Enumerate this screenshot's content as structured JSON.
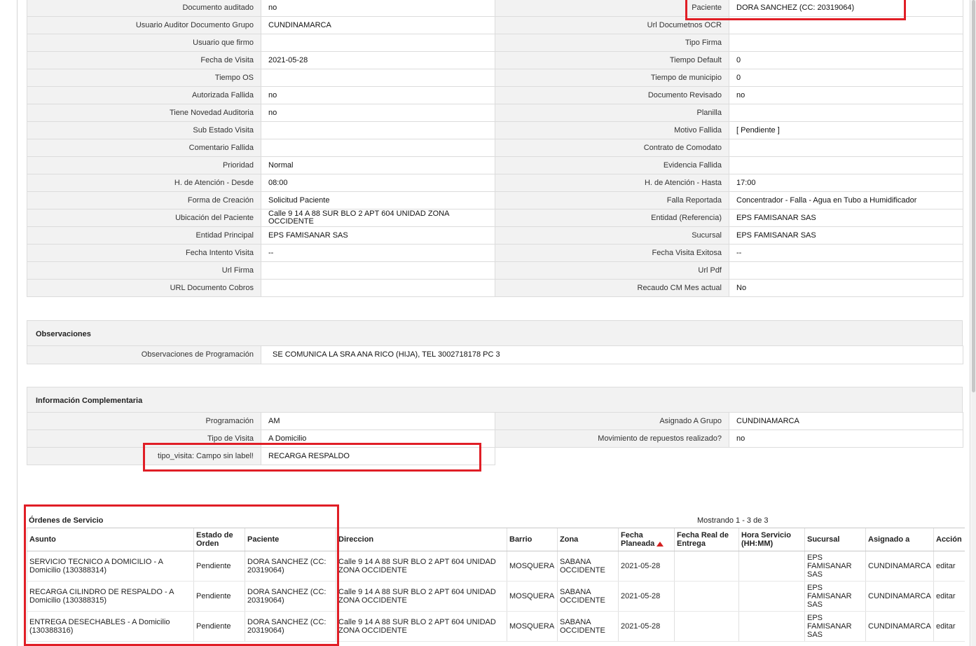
{
  "details": {
    "rows": [
      {
        "l1": "Documento auditado",
        "v1": "no",
        "l2": "Paciente",
        "v2": "DORA SANCHEZ (CC: 20319064)"
      },
      {
        "l1": "Usuario Auditor Documento Grupo",
        "v1": "CUNDINAMARCA",
        "l2": "Url Documetnos OCR",
        "v2": ""
      },
      {
        "l1": "Usuario que firmo",
        "v1": "",
        "l2": "Tipo Firma",
        "v2": ""
      },
      {
        "l1": "Fecha de Visita",
        "v1": "2021-05-28",
        "l2": "Tiempo Default",
        "v2": "0"
      },
      {
        "l1": "Tiempo OS",
        "v1": "",
        "l2": "Tiempo de municipio",
        "v2": "0"
      },
      {
        "l1": "Autorizada Fallida",
        "v1": "no",
        "l2": "Documento Revisado",
        "v2": "no"
      },
      {
        "l1": "Tiene Novedad Auditoria",
        "v1": "no",
        "l2": "Planilla",
        "v2": ""
      },
      {
        "l1": "Sub Estado Visita",
        "v1": "",
        "l2": "Motivo Fallida",
        "v2": "[ Pendiente ]"
      },
      {
        "l1": "Comentario Fallida",
        "v1": "",
        "l2": "Contrato de Comodato",
        "v2": ""
      },
      {
        "l1": "Prioridad",
        "v1": "Normal",
        "l2": "Evidencia Fallida",
        "v2": ""
      },
      {
        "l1": "H. de Atención - Desde",
        "v1": "08:00",
        "l2": "H. de Atención - Hasta",
        "v2": "17:00"
      },
      {
        "l1": "Forma de Creación",
        "v1": "Solicitud Paciente",
        "l2": "Falla Reportada",
        "v2": "Concentrador - Falla - Agua en Tubo a Humidificador"
      },
      {
        "l1": "Ubicación del Paciente",
        "v1": "Calle 9 14 A 88 SUR BLO 2 APT 604 UNIDAD ZONA OCCIDENTE",
        "l2": "Entidad (Referencia)",
        "v2": "EPS FAMISANAR SAS"
      },
      {
        "l1": "Entidad Principal",
        "v1": "EPS FAMISANAR SAS",
        "l2": "Sucursal",
        "v2": "EPS FAMISANAR SAS"
      },
      {
        "l1": "Fecha Intento Visita",
        "v1": "--",
        "l2": "Fecha Visita Exitosa",
        "v2": "--"
      },
      {
        "l1": "Url Firma",
        "v1": "",
        "l2": "Url Pdf",
        "v2": ""
      },
      {
        "l1": "URL Documento Cobros",
        "v1": "",
        "l2": "Recaudo CM Mes actual",
        "v2": "No"
      }
    ]
  },
  "observaciones": {
    "title": "Observaciones",
    "label": "Observaciones de Programación",
    "value": "SE COMUNICA LA SRA ANA RICO (HIJA), TEL 3002718178 PC 3"
  },
  "complementaria": {
    "title": "Información Complementaria",
    "rows": [
      {
        "l1": "Programación",
        "v1": "AM",
        "l2": "Asignado A Grupo",
        "v2": "CUNDINAMARCA"
      },
      {
        "l1": "Tipo de Visita",
        "v1": "A Domicilio",
        "l2": "Movimiento de repuestos realizado?",
        "v2": "no"
      },
      {
        "l1": "tipo_visita: Campo sin label!",
        "v1": "RECARGA RESPALDO"
      }
    ]
  },
  "ordenes": {
    "title": "Órdenes de Servicio",
    "count": "Mostrando 1 - 3 de 3",
    "columns": [
      "Asunto",
      "Estado de Orden",
      "Paciente",
      "Direccion",
      "Barrio",
      "Zona",
      "Fecha Planeada",
      "Fecha Real de Entrega",
      "Hora Servicio (HH:MM)",
      "Sucursal",
      "Asignado a",
      "Acción"
    ],
    "rows": [
      {
        "asunto": "SERVICIO TECNICO A DOMICILIO - A Domicilio (130388314)",
        "estado": "Pendiente",
        "paciente": "DORA SANCHEZ (CC: 20319064)",
        "direccion": "Calle 9 14 A 88 SUR BLO 2 APT 604 UNIDAD ZONA OCCIDENTE",
        "barrio": "MOSQUERA",
        "zona": "SABANA OCCIDENTE",
        "fecha": "2021-05-28",
        "fecha_real": "",
        "hora": "",
        "sucursal": "EPS FAMISANAR SAS",
        "asignado": "CUNDINAMARCA",
        "accion": "editar"
      },
      {
        "asunto": "RECARGA CILINDRO DE RESPALDO - A Domicilio (130388315)",
        "estado": "Pendiente",
        "paciente": "DORA SANCHEZ (CC: 20319064)",
        "direccion": "Calle 9 14 A 88 SUR BLO 2 APT 604 UNIDAD ZONA OCCIDENTE",
        "barrio": "MOSQUERA",
        "zona": "SABANA OCCIDENTE",
        "fecha": "2021-05-28",
        "fecha_real": "",
        "hora": "",
        "sucursal": "EPS FAMISANAR SAS",
        "asignado": "CUNDINAMARCA",
        "accion": "editar"
      },
      {
        "asunto": "ENTREGA DESECHABLES - A Domicilio (130388316)",
        "estado": "Pendiente",
        "paciente": "DORA SANCHEZ (CC: 20319064)",
        "direccion": "Calle 9 14 A 88 SUR BLO 2 APT 604 UNIDAD ZONA OCCIDENTE",
        "barrio": "MOSQUERA",
        "zona": "SABANA OCCIDENTE",
        "fecha": "2021-05-28",
        "fecha_real": "",
        "hora": "",
        "sucursal": "EPS FAMISANAR SAS",
        "asignado": "CUNDINAMARCA",
        "accion": "editar"
      }
    ]
  },
  "colors": {
    "highlight": "#e01e26",
    "label_bg": "#f2f2f2",
    "border": "#dcdcdc"
  }
}
